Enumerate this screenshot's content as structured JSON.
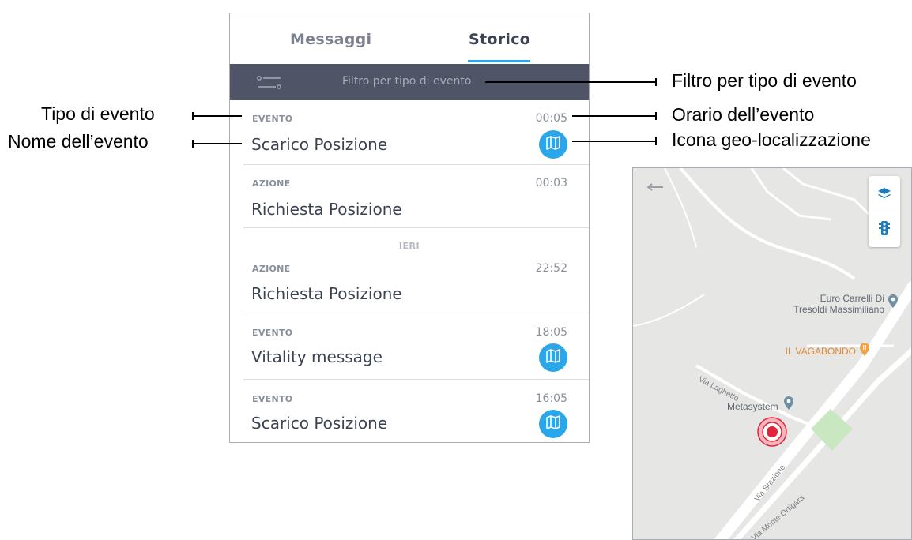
{
  "tabs": {
    "messaggi": "Messaggi",
    "storico": "Storico"
  },
  "filter": {
    "label": "Filtro per tipo di evento"
  },
  "events": [
    {
      "type": "EVENTO",
      "time": "00:05",
      "name": "Scarico Posizione",
      "has_map": true
    },
    {
      "type": "AZIONE",
      "time": "00:03",
      "name": "Richiesta Posizione",
      "has_map": false
    },
    {
      "type": "AZIONE",
      "time": "22:52",
      "name": "Richiesta Posizione",
      "has_map": false
    },
    {
      "type": "EVENTO",
      "time": "18:05",
      "name": "Vitality message",
      "has_map": true
    },
    {
      "type": "EVENTO",
      "time": "16:05",
      "name": "Scarico Posizione",
      "has_map": true
    }
  ],
  "day_separator": "IERI",
  "annotations": {
    "filter": "Filtro per tipo di evento",
    "event_type": "Tipo di evento",
    "event_name": "Nome dell’evento",
    "event_time": "Orario dell’evento",
    "geo_icon": "Icona geo-localizzazione"
  },
  "map": {
    "poi_1_line1": "Euro Carrelli Di",
    "poi_1_line2": "Tresoldi Massimiliano",
    "poi_2": "IL VAGABONDO",
    "poi_3": "Metasystem",
    "street_1": "Via Laghetto",
    "street_2": "Via Stazione",
    "street_3": "Via Monte Ortigara"
  },
  "colors": {
    "accent": "#2aa6ea",
    "filter_bar": "#4f5566",
    "location_marker": "#e0243a",
    "restaurant_poi": "#f0a045",
    "map_park": "#c9e8c2"
  },
  "icons": {
    "filter": "sliders-icon",
    "geo": "map-icon",
    "back": "arrow-left-icon",
    "layers": "layers-icon",
    "traffic": "traffic-light-icon"
  }
}
